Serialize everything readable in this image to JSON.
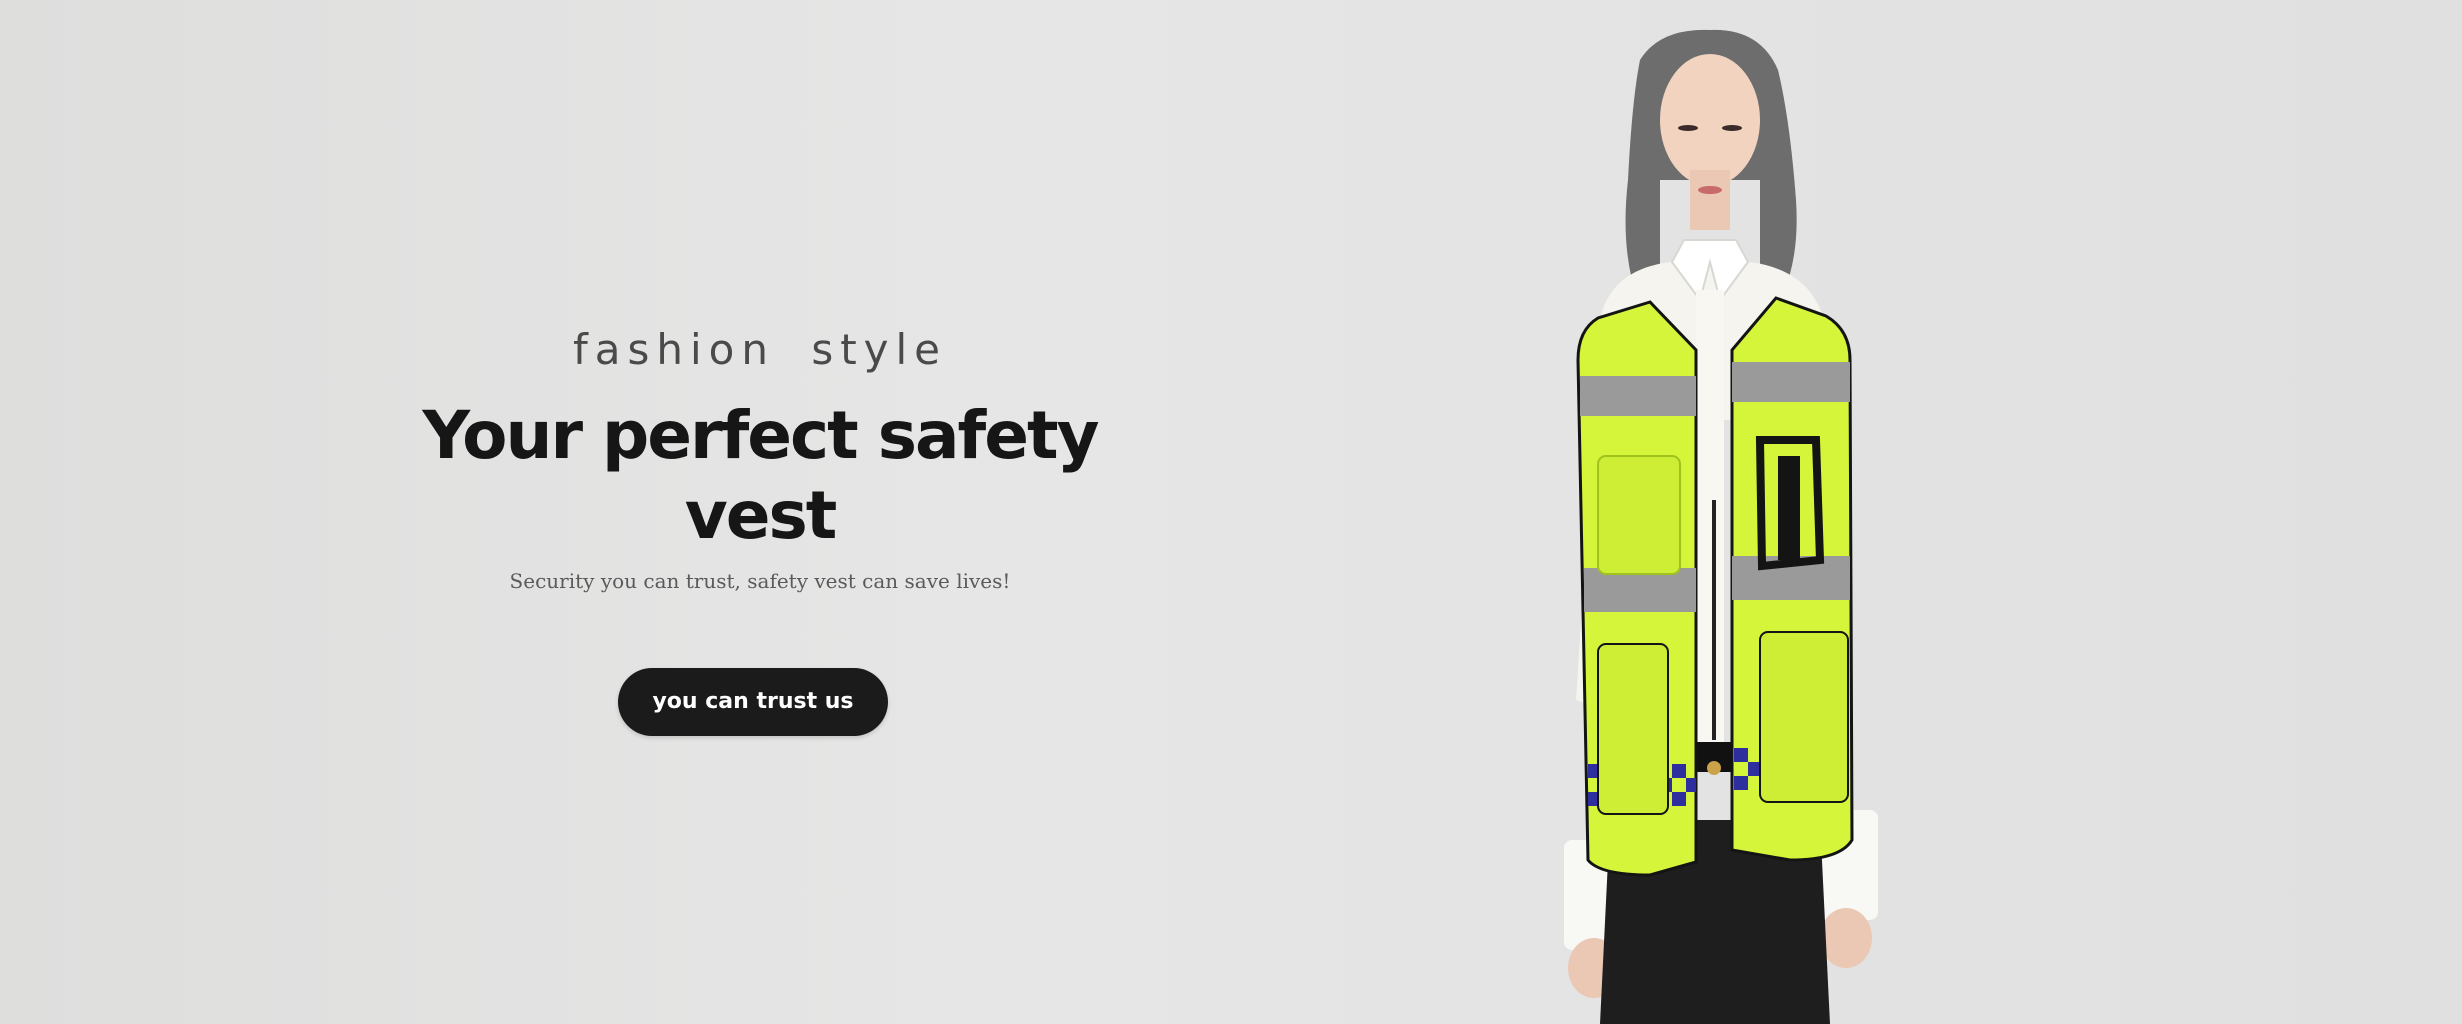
{
  "hero": {
    "eyebrow": "fashion  style",
    "headline": "Your perfect safety vest",
    "subline": "Security you can trust, safety vest can save lives!",
    "cta_label": "you can trust us"
  },
  "colors": {
    "background": "#e3e3e3",
    "headline": "#161616",
    "cta_background": "#1b1b1b",
    "cta_text": "#ffffff",
    "vest_fluorescent": "#d4f53a",
    "reflective_stripe": "#9a9a9a",
    "checker_blue": "#2e2e9e"
  },
  "image": {
    "subject": "model-wearing-safety-vest"
  }
}
